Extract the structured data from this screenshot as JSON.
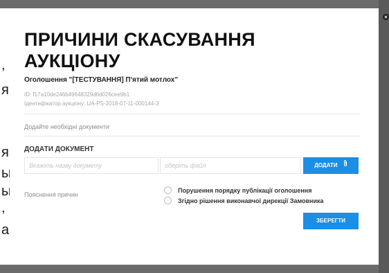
{
  "background": {
    "fragments": [
      ",",
      "я",
      "я",
      "ы",
      "ы",
      ",",
      "а"
    ]
  },
  "modal": {
    "title": "ПРИЧИНИ СКАСУВАННЯ АУКЦІОНУ",
    "subtitle": "Оголошення \"[ТЕСТУВАННЯ] П'ятий мотлох\"",
    "id_line": "ID: f17a10de246b49648329d6d026cee9b1",
    "auction_id_line": "Ідентифікатор аукціону: UA-PS-2018-07-11-000144-3",
    "documents_hint": "Додайте необхідні документи",
    "add_document_title": "ДОДАТИ ДОКУМЕНТ",
    "document_name_placeholder": "Вкажіть назву докумету",
    "file_placeholder": "оберіть файл",
    "add_button_label": "ДОДАТИ",
    "reasons_label": "Пояснення причин",
    "reasons": [
      "Порушення порядку публікації оголошення",
      "Згідно рішення виконавчої дирекції Замовника"
    ],
    "save_button_label": "ЗБЕРЕГТИ"
  },
  "colors": {
    "accent": "#1b8ee6",
    "overlay": "#5a5a5a"
  },
  "icons": {
    "attach": "paperclip-icon",
    "close": "close-icon"
  }
}
